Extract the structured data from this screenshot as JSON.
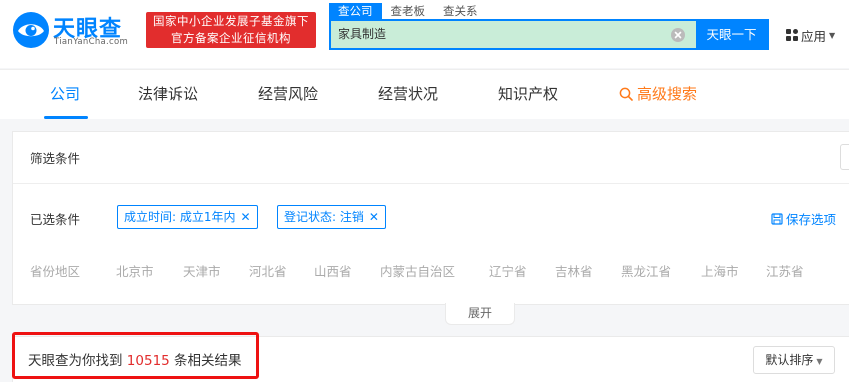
{
  "header": {
    "logo_cn": "天眼查",
    "logo_en": "TianYanCha.com",
    "slogan_line1": "国家中小企业发展子基金旗下",
    "slogan_line2": "官方备案企业征信机构",
    "search_tabs": [
      {
        "label": "查公司",
        "active": true
      },
      {
        "label": "查老板",
        "active": false
      },
      {
        "label": "查关系",
        "active": false
      }
    ],
    "search_value": "家具制造",
    "search_button": "天眼一下",
    "apps_label": "应用"
  },
  "nav": {
    "items": [
      "公司",
      "法律诉讼",
      "经营风险",
      "经营状况",
      "知识产权"
    ],
    "advanced": "高级搜索",
    "active_index": 0
  },
  "filter": {
    "title": "筛选条件",
    "selected_label": "已选条件",
    "chips": [
      "成立时间: 成立1年内",
      "登记状态: 注销"
    ],
    "save_label": "保存选项",
    "province_label": "省份地区",
    "provinces": [
      "北京市",
      "天津市",
      "河北省",
      "山西省",
      "内蒙古自治区",
      "辽宁省",
      "吉林省",
      "黑龙江省",
      "上海市",
      "江苏省"
    ],
    "expand_label": "展开"
  },
  "results": {
    "prefix": "天眼查为你找到",
    "count": "10515",
    "suffix": "条相关结果",
    "sort_label": "默认排序"
  },
  "colors": {
    "brand": "#0084ff",
    "slogan_bg": "#e22d2d",
    "advanced_search": "#ff7a1a",
    "highlight_box": "#ee1111",
    "search_fill": "#c9edd8"
  }
}
